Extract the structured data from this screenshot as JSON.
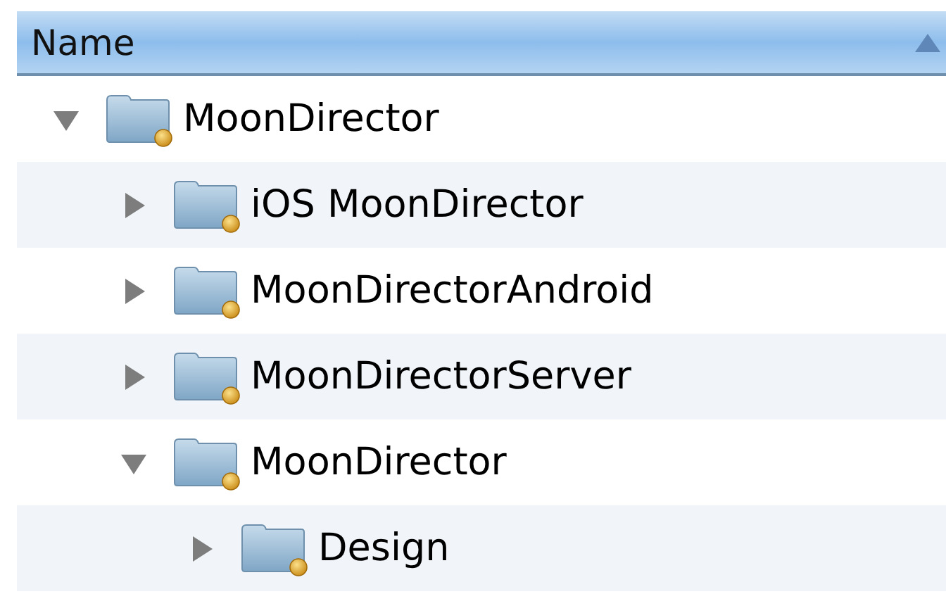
{
  "header": {
    "column": "Name",
    "sort_ascending": true
  },
  "tree": [
    {
      "name": "MoonDirector",
      "expanded": true,
      "children": [
        {
          "name": "iOS MoonDirector",
          "expanded": false
        },
        {
          "name": "MoonDirectorAndroid",
          "expanded": false
        },
        {
          "name": "MoonDirectorServer",
          "expanded": false
        },
        {
          "name": "MoonDirector",
          "expanded": true,
          "children": [
            {
              "name": "Design",
              "expanded": false
            }
          ]
        }
      ]
    }
  ]
}
